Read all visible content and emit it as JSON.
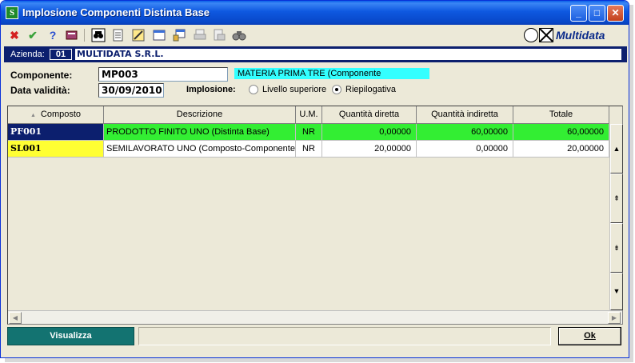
{
  "window": {
    "title": "Implosione Componenti Distinta Base",
    "icon": "S",
    "minimize": "_",
    "maximize": "□",
    "close": "✕"
  },
  "toolbar": {
    "icons": [
      "cancel-icon",
      "confirm-icon",
      "help-icon",
      "book-icon",
      "binoculars-icon",
      "page-icon",
      "edit-icon",
      "window-icon",
      "lock-window-icon",
      "print-icon",
      "print-preview-icon",
      "search-icon"
    ],
    "logo_text": "Multidata"
  },
  "azienda": {
    "label": "Azienda:",
    "code": "01",
    "name": "MULTIDATA S.R.L."
  },
  "form": {
    "componente_label": "Componente:",
    "componente_value": "MP003",
    "componente_desc": "MATERIA PRIMA TRE (Componente",
    "data_label": "Data validità:",
    "data_value": "30/09/2010",
    "implosione_label": "Implosione:",
    "option_livello": "Livello superiore",
    "option_riepilogativa": "Riepilogativa",
    "selected_option": "Riepilogativa"
  },
  "grid": {
    "columns": [
      "Composto",
      "Descrizione",
      "U.M.",
      "Quantità diretta",
      "Quantità indiretta",
      "Totale"
    ],
    "sort_indicator": "▲",
    "rows": [
      {
        "composto": "PF001",
        "descrizione": "PRODOTTO FINITO UNO (Distinta Base)",
        "um": "NR",
        "diretta": "0,00000",
        "indiretta": "60,00000",
        "totale": "60,00000"
      },
      {
        "composto": "SL001",
        "descrizione": "SEMILAVORATO UNO (Composto-Componente)",
        "um": "NR",
        "diretta": "20,00000",
        "indiretta": "0,00000",
        "totale": "20,00000"
      }
    ],
    "scroll_buttons": [
      "▲",
      "⇞",
      "⇟",
      "▼"
    ]
  },
  "buttons": {
    "visualizza": "Visualizza",
    "ok": "Ok"
  },
  "colors": {
    "title_bar": "#0a52d8",
    "azienda_bar": "#0c1f6e",
    "row1_code_bg": "#0c1f6e",
    "row1_bg": "#33ee33",
    "row2_code_bg": "#ffff33",
    "desc_field_bg": "#33ffff",
    "visualizza_bg": "#137371"
  }
}
